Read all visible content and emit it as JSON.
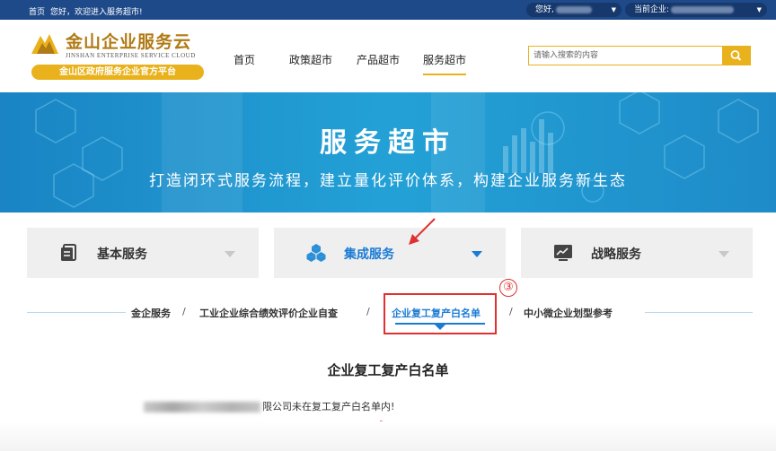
{
  "topbar": {
    "home_link": "首页",
    "welcome": "您好，欢迎进入服务超市!",
    "user_label": "您好,",
    "company_label": "当前企业:"
  },
  "logo": {
    "title": "金山企业服务云",
    "subtitle_en": "JINSHAN ENTERPRISE SERVICE CLOUD",
    "slogan": "金山区政府服务企业官方平台"
  },
  "nav": {
    "items": [
      "首页",
      "政策超市",
      "产品超市",
      "服务超市"
    ],
    "active": "服务超市"
  },
  "search": {
    "placeholder": "请输入搜索的内容"
  },
  "banner": {
    "title": "服务超市",
    "subtitle": "打造闭环式服务流程，建立量化评价体系，构建企业服务新生态"
  },
  "tabs": [
    {
      "label": "基本服务",
      "icon": "document-icon",
      "active": false
    },
    {
      "label": "集成服务",
      "icon": "cubes-icon",
      "active": true
    },
    {
      "label": "战略服务",
      "icon": "chart-icon",
      "active": false
    }
  ],
  "subnav": {
    "items": [
      "金企服务",
      "工业企业综合绩效评价企业自查",
      "企业复工复产白名单",
      "中小微企业划型参考"
    ],
    "separator": "/",
    "active": "企业复工复产白名单"
  },
  "annotation": {
    "step_number": "③",
    "color": "#e03030"
  },
  "result": {
    "title": "企业复工复产白名单",
    "message": "限公司未在复工复产白名单内!"
  },
  "colors": {
    "accent_blue": "#1a7bd4",
    "brand_gold": "#e9b21c",
    "topbar": "#1f4a8a"
  }
}
